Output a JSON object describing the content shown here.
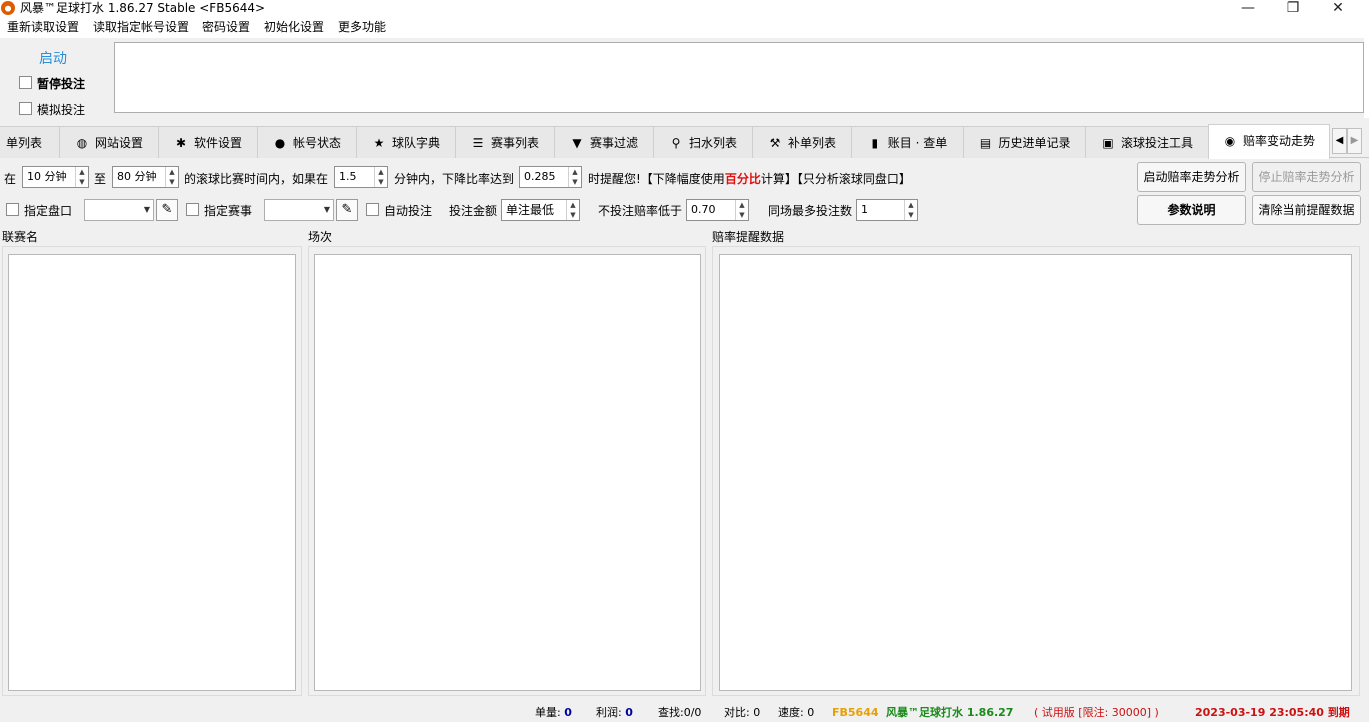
{
  "window": {
    "title": "风暴™足球打水 1.86.27 Stable <FB5644>",
    "minimize": "—",
    "maximize": "❐",
    "close": "✕"
  },
  "menu": [
    "重新读取设置",
    "读取指定帐号设置",
    "密码设置",
    "初始化设置",
    "更多功能"
  ],
  "controls": {
    "start": "启动",
    "pause_bet": "暂停投注",
    "simulate_bet": "模拟投注"
  },
  "tabs": [
    {
      "label": "单列表",
      "icon": ""
    },
    {
      "label": "网站设置",
      "icon": "globe-icon"
    },
    {
      "label": "软件设置",
      "icon": "gear-icon"
    },
    {
      "label": "帐号状态",
      "icon": "user-icon"
    },
    {
      "label": "球队字典",
      "icon": "star-icon"
    },
    {
      "label": "赛事列表",
      "icon": "list-icon"
    },
    {
      "label": "赛事过滤",
      "icon": "filter-icon"
    },
    {
      "label": "扫水列表",
      "icon": "search-icon"
    },
    {
      "label": "补单列表",
      "icon": "gavel-icon"
    },
    {
      "label": "账目 · 查单",
      "icon": "file-icon"
    },
    {
      "label": "历史进单记录",
      "icon": "doc-icon"
    },
    {
      "label": "滚球投注工具",
      "icon": "ticket-icon"
    },
    {
      "label": "赔率变动走势",
      "icon": "eye-icon"
    }
  ],
  "active_tab": "赔率变动走势",
  "odds_form": {
    "in": "在",
    "from_min": "10 分钟",
    "to": "至",
    "to_min": "80 分钟",
    "text1": "的滚球比赛时间内，如果在",
    "within": "1.5",
    "text2": "分钟内，下降比率达到",
    "drop_rate": "0.285",
    "text3": "时提醒您!【下降幅度使用",
    "percent_highlight": "百分比",
    "text4": "计算】【只分析滚球同盘口】",
    "specify_market": "指定盘口",
    "specify_event": "指定赛事",
    "auto_bet": "自动投注",
    "bet_amount_label": "投注金额",
    "bet_amount": "单注最低",
    "min_odds_label": "不投注赔率低于",
    "min_odds": "0.70",
    "max_bets_label": "同场最多投注数",
    "max_bets": "1",
    "btn_start_analysis": "启动赔率走势分析",
    "btn_stop_analysis": "停止赔率走势分析",
    "btn_params": "参数说明",
    "btn_clear": "清除当前提醒数据"
  },
  "columns": {
    "league": "联赛名",
    "match": "场次",
    "alerts": "赔率提醒数据"
  },
  "status": {
    "orders_label": "单量:",
    "orders": "0",
    "profit_label": "利润:",
    "profit": "0",
    "query_label": "查找:",
    "query": "0/0",
    "ratio_label": "对比:",
    "ratio": "0",
    "speed_label": "速度:",
    "speed": "0",
    "account": "FB5644",
    "app_name": "风暴™足球打水 1.86.27",
    "trial": "( 试用版 [限注: 30000] )",
    "expiry": "2023-03-19 23:05:40 到期"
  },
  "colors": {
    "accent_blue": "#2a8fd6",
    "highlight_red": "#e01010",
    "status_orange": "#e8a000",
    "status_green": "#1a8a1a",
    "status_red": "#cc1010",
    "status_navy": "#0000a0"
  }
}
